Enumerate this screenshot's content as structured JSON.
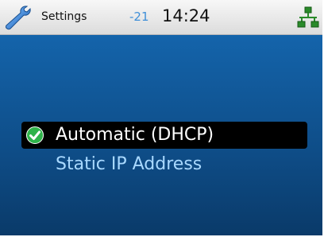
{
  "status_bar": {
    "title": "Settings",
    "signal": "-21",
    "time": "14:24",
    "left_icon": "wrench-icon",
    "right_icon": "network-icon"
  },
  "menu": {
    "items": [
      {
        "label": "Automatic (DHCP)",
        "selected": true,
        "icon": "check-circle-icon"
      },
      {
        "label": "Static IP Address",
        "selected": false
      }
    ]
  },
  "colors": {
    "accent_blue": "#3f8fd8",
    "background_top": "#1464ab",
    "background_bottom": "#0a3a69",
    "selection_bg": "#000000",
    "unselected_text": "#a9d9ff",
    "check_green": "#2fb34a"
  }
}
